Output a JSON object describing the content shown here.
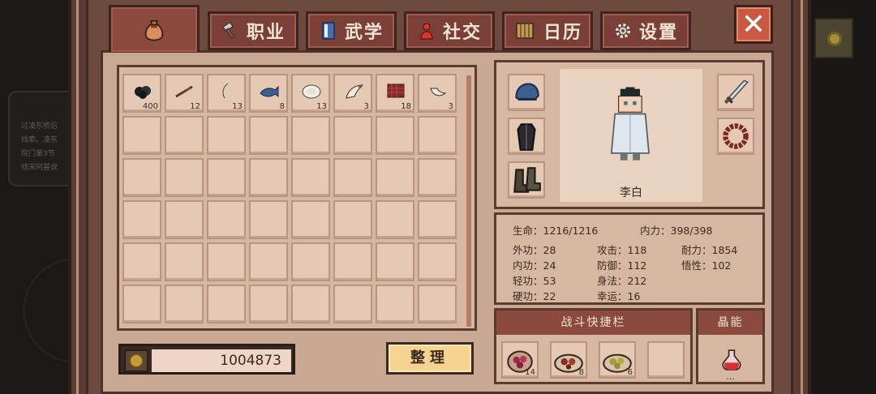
{
  "background": {
    "quest_lines": [
      "过凌东桥后",
      "线索。凌东",
      "院门第3节",
      "",
      "找宋阿甚说"
    ]
  },
  "tabs": [
    {
      "label": "",
      "icon": "bag-icon"
    },
    {
      "label": "职业",
      "icon": "hammer-icon"
    },
    {
      "label": "武学",
      "icon": "book-icon"
    },
    {
      "label": "社交",
      "icon": "person-icon"
    },
    {
      "label": "日历",
      "icon": "calendar-icon"
    },
    {
      "label": "设置",
      "icon": "gear-icon"
    }
  ],
  "close_icon": "close-icon",
  "inventory": {
    "items": [
      {
        "icon": "coal-icon",
        "count": "400"
      },
      {
        "icon": "rod-icon",
        "count": "12"
      },
      {
        "icon": "hook-icon",
        "count": "13"
      },
      {
        "icon": "fish-icon",
        "count": "8"
      },
      {
        "icon": "rice-ball-icon",
        "count": "13"
      },
      {
        "icon": "claw-icon",
        "count": "3"
      },
      {
        "icon": "fabric-icon",
        "count": "18"
      },
      {
        "icon": "horn-icon",
        "count": "3"
      }
    ],
    "slot_count": 48
  },
  "money": {
    "amount": "1004873",
    "icon": "coin-icon"
  },
  "sort_button": "整理",
  "equipment": {
    "left_slots": [
      "hat-icon",
      "robe-icon",
      "boots-icon"
    ],
    "right_slots": [
      "sword-icon",
      "beads-icon"
    ],
    "character_name": "李白"
  },
  "stats": {
    "hp": "生命：1216/1216",
    "mp": "内力：398/398",
    "rows": [
      [
        "外功：28",
        "攻击：118",
        "耐力：1854"
      ],
      [
        "内功：24",
        "防御：112",
        "悟性：102"
      ],
      [
        "轻功：53",
        "身法：212",
        ""
      ],
      [
        "硬功：22",
        "幸运：16",
        ""
      ]
    ]
  },
  "quickbar": {
    "title": "战斗快捷栏",
    "items": [
      {
        "icon": "berry-bowl-icon",
        "count": "14"
      },
      {
        "icon": "meat-plate-icon",
        "count": "8"
      },
      {
        "icon": "bun-plate-icon",
        "count": "6"
      },
      {
        "icon": "",
        "count": ""
      }
    ]
  },
  "crystal": {
    "title": "晶能",
    "icon": "potion-icon",
    "count": "..."
  },
  "colors": {
    "tab": "#7a3f36",
    "panel": "#c9a993",
    "accent_button": "#f6d48f"
  }
}
